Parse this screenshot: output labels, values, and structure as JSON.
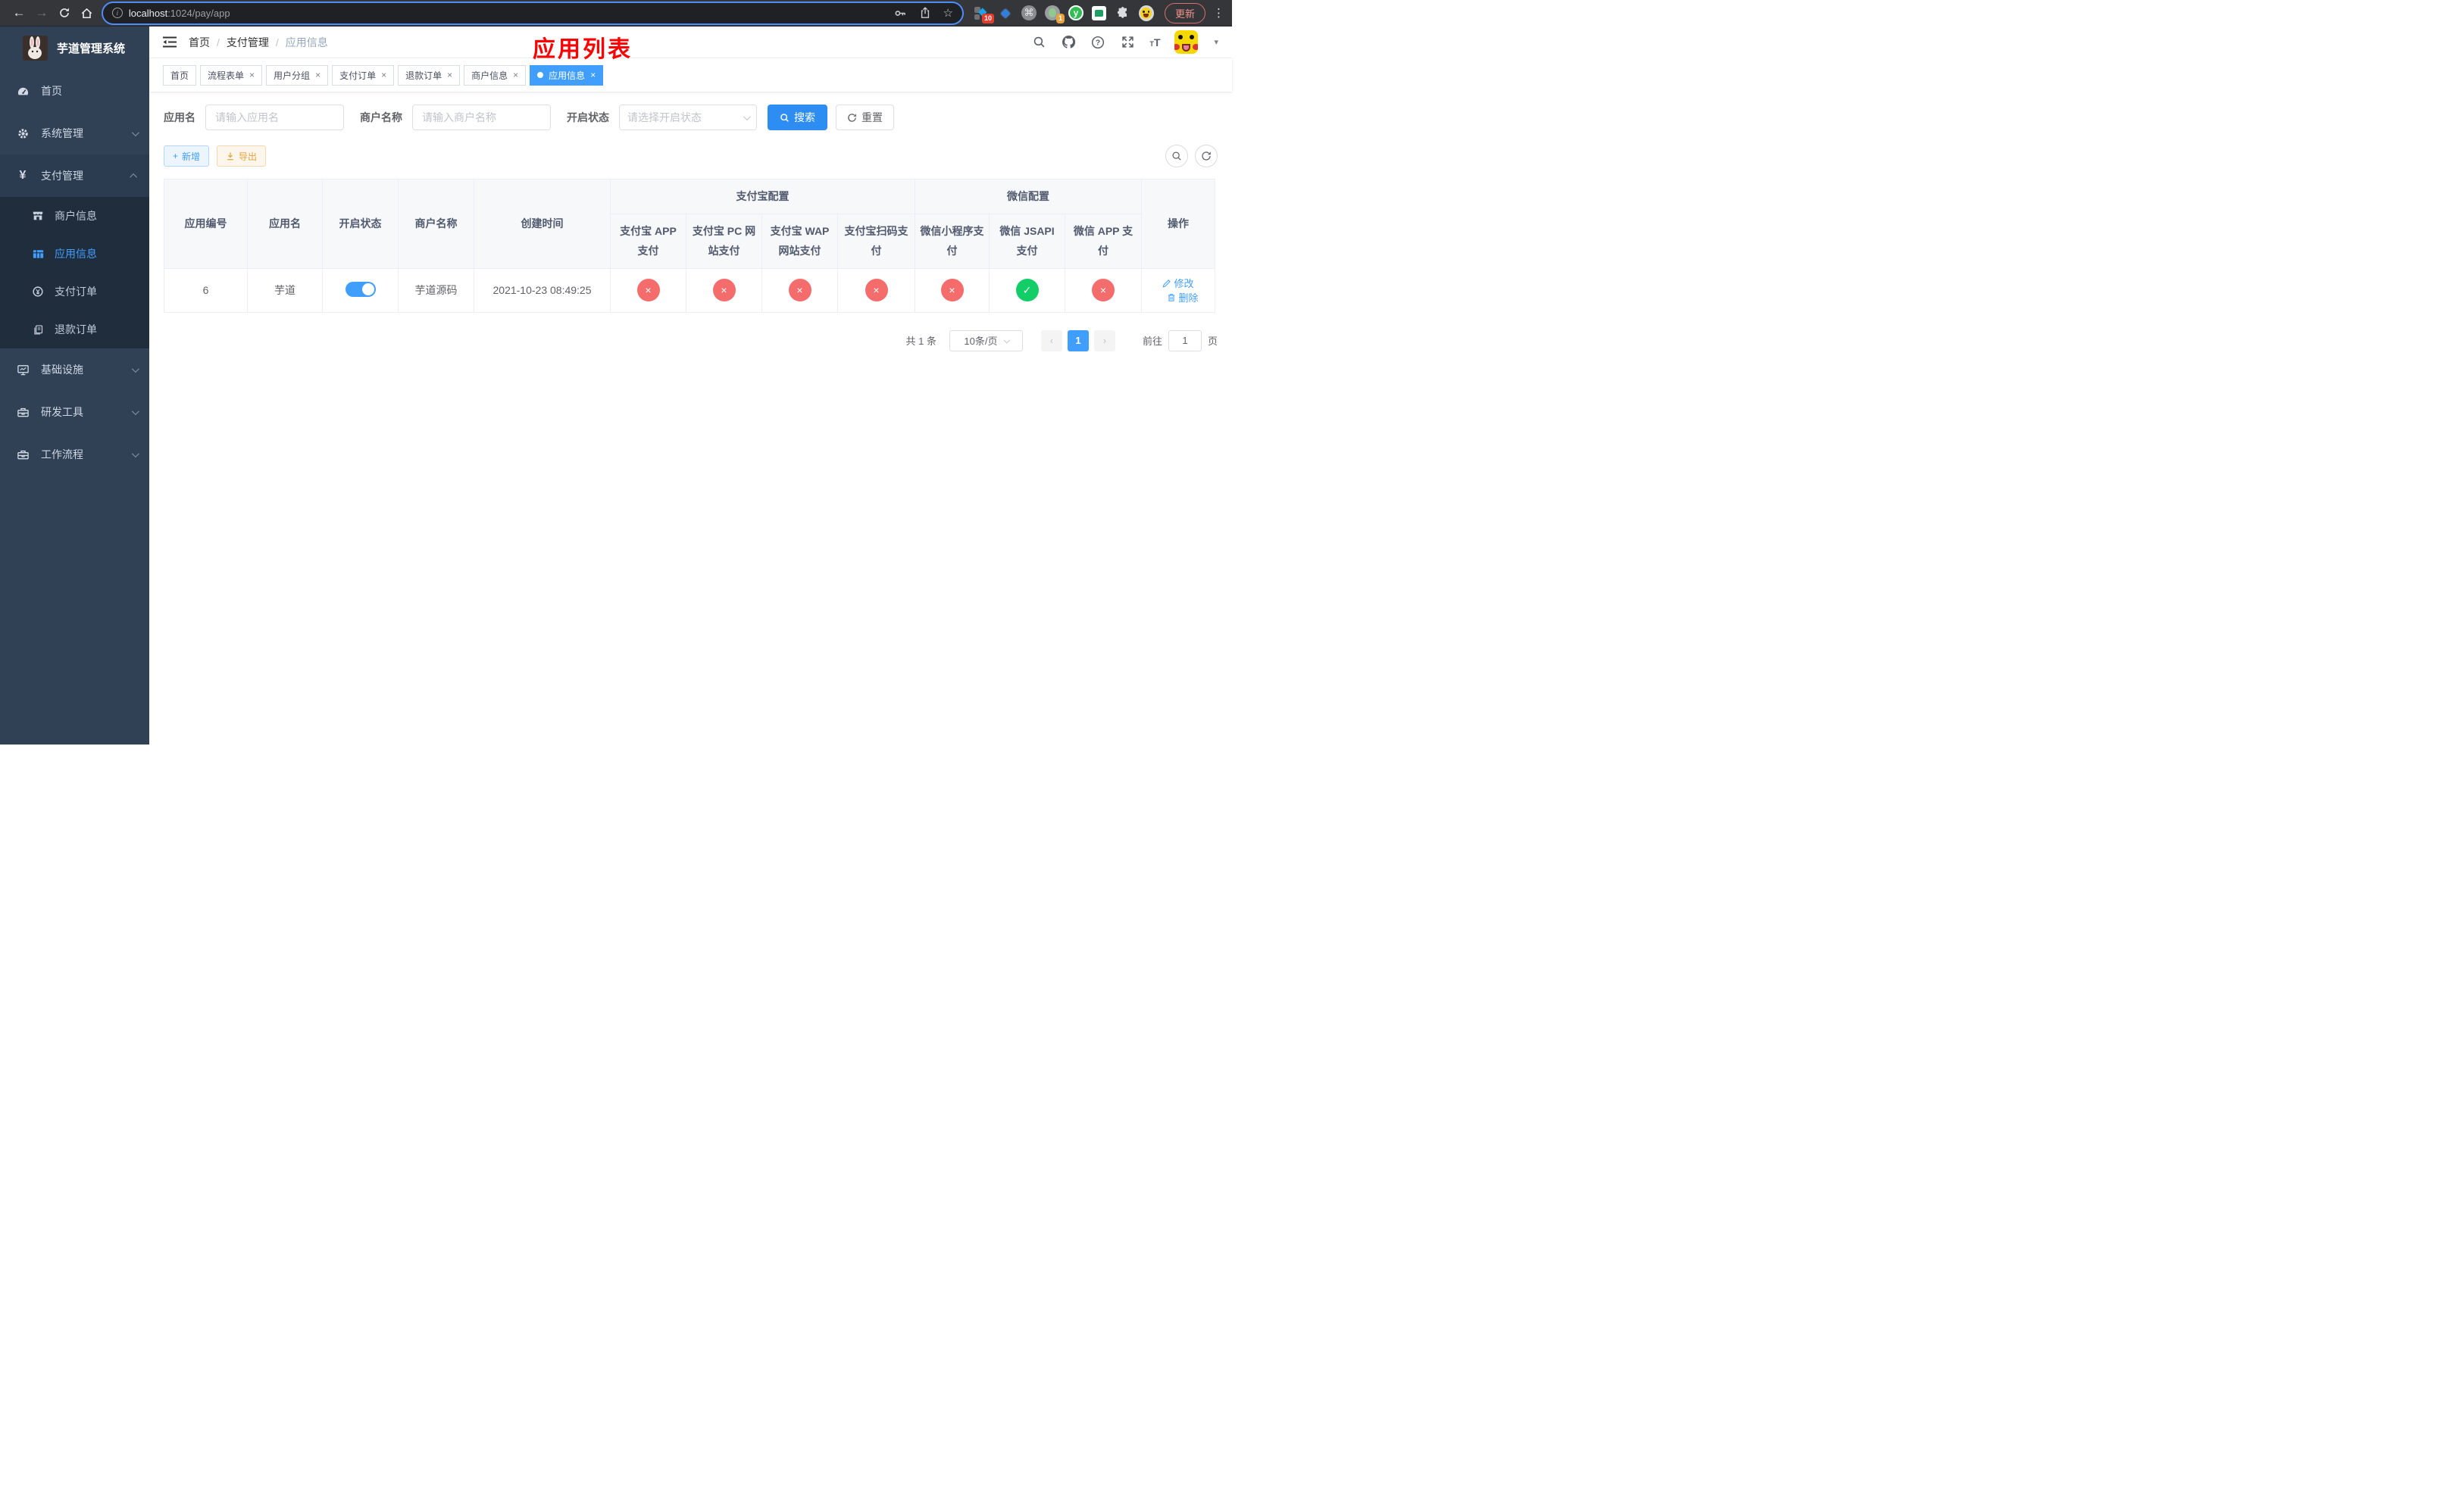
{
  "colors": {
    "accent": "#409eff",
    "success": "#13ce66",
    "danger": "#f56c6c",
    "warning": "#e6a23c",
    "annotation_red": "#ff0000",
    "sidebar_bg": "#304156",
    "submenu_bg": "#1f2d3d",
    "active_tab_bg": "#409eff"
  },
  "browser": {
    "url_host": "localhost",
    "url_rest": ":1024/pay/app",
    "ext_badge_10": "10",
    "ext_badge_1": "1",
    "ext_y_label": "y",
    "update_label": "更新"
  },
  "icons": {
    "close": "×",
    "back": "←",
    "forward": "→",
    "star": "☆",
    "command": "⌘",
    "diamond": "◆",
    "more": "⋮",
    "caret": "▾",
    "info": "i",
    "plus": "+"
  },
  "sidebar": {
    "title": "芋道管理系统",
    "items": [
      {
        "label": "首页"
      },
      {
        "label": "系统管理"
      },
      {
        "label": "支付管理"
      },
      {
        "label": "商户信息"
      },
      {
        "label": "应用信息"
      },
      {
        "label": "支付订单"
      },
      {
        "label": "退款订单"
      },
      {
        "label": "基础设施"
      },
      {
        "label": "研发工具"
      },
      {
        "label": "工作流程"
      }
    ]
  },
  "header": {
    "breadcrumb": [
      "首页",
      "支付管理",
      "应用信息"
    ],
    "annotation": "应用列表"
  },
  "tabs": [
    {
      "label": "首页"
    },
    {
      "label": "流程表单"
    },
    {
      "label": "用户分组"
    },
    {
      "label": "支付订单"
    },
    {
      "label": "退款订单"
    },
    {
      "label": "商户信息"
    },
    {
      "label": "应用信息"
    }
  ],
  "filters": {
    "name_label": "应用名",
    "name_placeholder": "请输入应用名",
    "merchant_label": "商户名称",
    "merchant_placeholder": "请输入商户名称",
    "status_label": "开启状态",
    "status_placeholder": "请选择开启状态",
    "search_label": "搜索",
    "reset_label": "重置"
  },
  "toolbar": {
    "add_label": "新增",
    "export_label": "导出"
  },
  "table": {
    "columns": [
      "应用编号",
      "应用名",
      "开启状态",
      "商户名称",
      "创建时间"
    ],
    "groups": {
      "alipay": "支付宝配置",
      "wechat": "微信配置"
    },
    "subcolumns": [
      "支付宝 APP 支付",
      "支付宝 PC 网站支付",
      "支付宝 WAP 网站支付",
      "支付宝扫码支付",
      "微信小程序支付",
      "微信 JSAPI 支付",
      "微信 APP 支付"
    ],
    "op_column": "操作",
    "row": {
      "id": "6",
      "name": "芋道",
      "enabled": true,
      "merchant": "芋道源码",
      "created": "2021-10-23 08:49:25",
      "statuses": [
        false,
        false,
        false,
        false,
        false,
        true,
        false
      ],
      "edit_label": "修改",
      "delete_label": "删除"
    },
    "status_glyphs": {
      "yes": "✓",
      "no": "×"
    }
  },
  "pagination": {
    "total": "共 1 条",
    "per_page": "10条/页",
    "page": "1",
    "prev": "‹",
    "next": "›",
    "goto_prefix": "前往",
    "goto_value": "1",
    "goto_suffix": "页"
  }
}
